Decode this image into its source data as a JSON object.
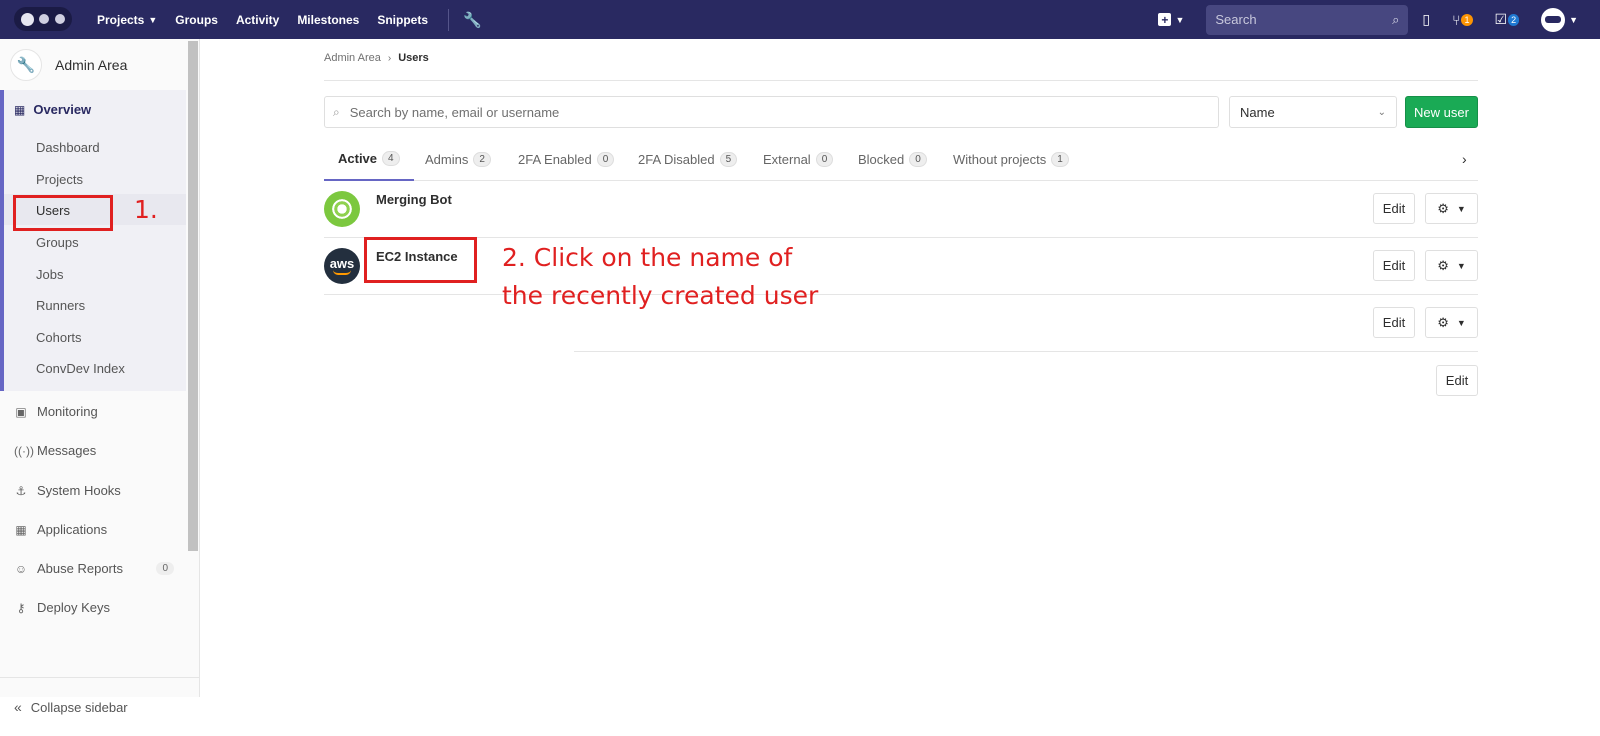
{
  "navbar": {
    "links": [
      "Projects",
      "Groups",
      "Activity",
      "Milestones",
      "Snippets"
    ],
    "search_placeholder": "Search",
    "merge_requests_count": "1",
    "todos_count": "2"
  },
  "sidebar": {
    "title": "Admin Area",
    "overview_label": "Overview",
    "overview_items": [
      "Dashboard",
      "Projects",
      "Users",
      "Groups",
      "Jobs",
      "Runners",
      "Cohorts",
      "ConvDev Index"
    ],
    "items": [
      {
        "label": "Monitoring",
        "icon": "monitor-icon"
      },
      {
        "label": "Messages",
        "icon": "broadcast-icon"
      },
      {
        "label": "System Hooks",
        "icon": "hook-icon"
      },
      {
        "label": "Applications",
        "icon": "grid-icon"
      },
      {
        "label": "Abuse Reports",
        "icon": "face-icon",
        "count": "0"
      },
      {
        "label": "Deploy Keys",
        "icon": "key-icon"
      }
    ],
    "collapse_label": "Collapse sidebar"
  },
  "breadcrumb": {
    "parent": "Admin Area",
    "current": "Users"
  },
  "toolbar": {
    "search_placeholder": "Search by name, email or username",
    "sort_value": "Name",
    "new_user_label": "New user"
  },
  "tabs": [
    {
      "label": "Active",
      "count": "4"
    },
    {
      "label": "Admins",
      "count": "2"
    },
    {
      "label": "2FA Enabled",
      "count": "0"
    },
    {
      "label": "2FA Disabled",
      "count": "5"
    },
    {
      "label": "External",
      "count": "0"
    },
    {
      "label": "Blocked",
      "count": "0"
    },
    {
      "label": "Without projects",
      "count": "1"
    }
  ],
  "users": [
    {
      "name": "Merging Bot"
    },
    {
      "name": "EC2 Instance"
    },
    {
      "name": ""
    },
    {
      "name": ""
    }
  ],
  "edit_label": "Edit",
  "annotations": {
    "step1": "1.",
    "step2_line1": "2. Click on the name of",
    "step2_line2": "the recently created user",
    "color": "#e02020"
  },
  "colors": {
    "navbar": "#292961",
    "accent": "#6666c4",
    "success": "#1aaa55"
  }
}
